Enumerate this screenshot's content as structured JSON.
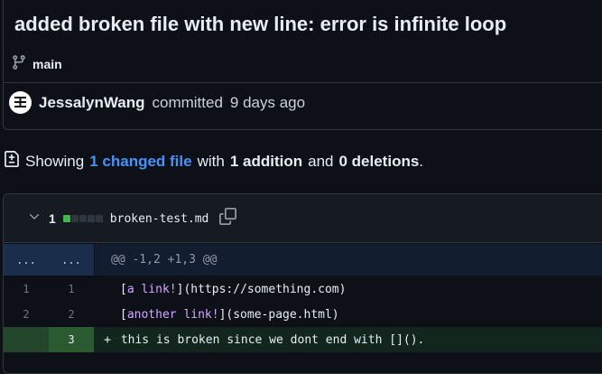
{
  "commit": {
    "title": "added broken file with new line: error is infinite loop",
    "branch": "main",
    "author": "JessalynWang",
    "action": "committed",
    "time": "9 days ago"
  },
  "summary": {
    "prefix": "Showing",
    "changed_files": "1 changed file",
    "with": "with",
    "additions": "1 addition",
    "and": "and",
    "deletions": "0 deletions",
    "end": "."
  },
  "file": {
    "change_count": "1",
    "name": "broken-test.md"
  },
  "diff": {
    "hunk_left": "...",
    "hunk_right": "...",
    "hunk_header": "@@ -1,2 +1,3 @@",
    "lines": [
      {
        "old": "1",
        "new": "1",
        "prefix": " ",
        "text_open": "[",
        "link_text": "a link!",
        "text_close": "](https://something.com)"
      },
      {
        "old": "2",
        "new": "2",
        "prefix": " ",
        "text_open": "[",
        "link_text": "another link!",
        "text_close": "](some-page.html)"
      },
      {
        "old": "",
        "new": "3",
        "prefix": "+",
        "text": " this is broken since we dont end with []()."
      }
    ]
  },
  "colors": {
    "background": "#0d1117",
    "link": "#4493f8",
    "addition": "#3fb950",
    "hunk_bg": "#121d2f"
  }
}
